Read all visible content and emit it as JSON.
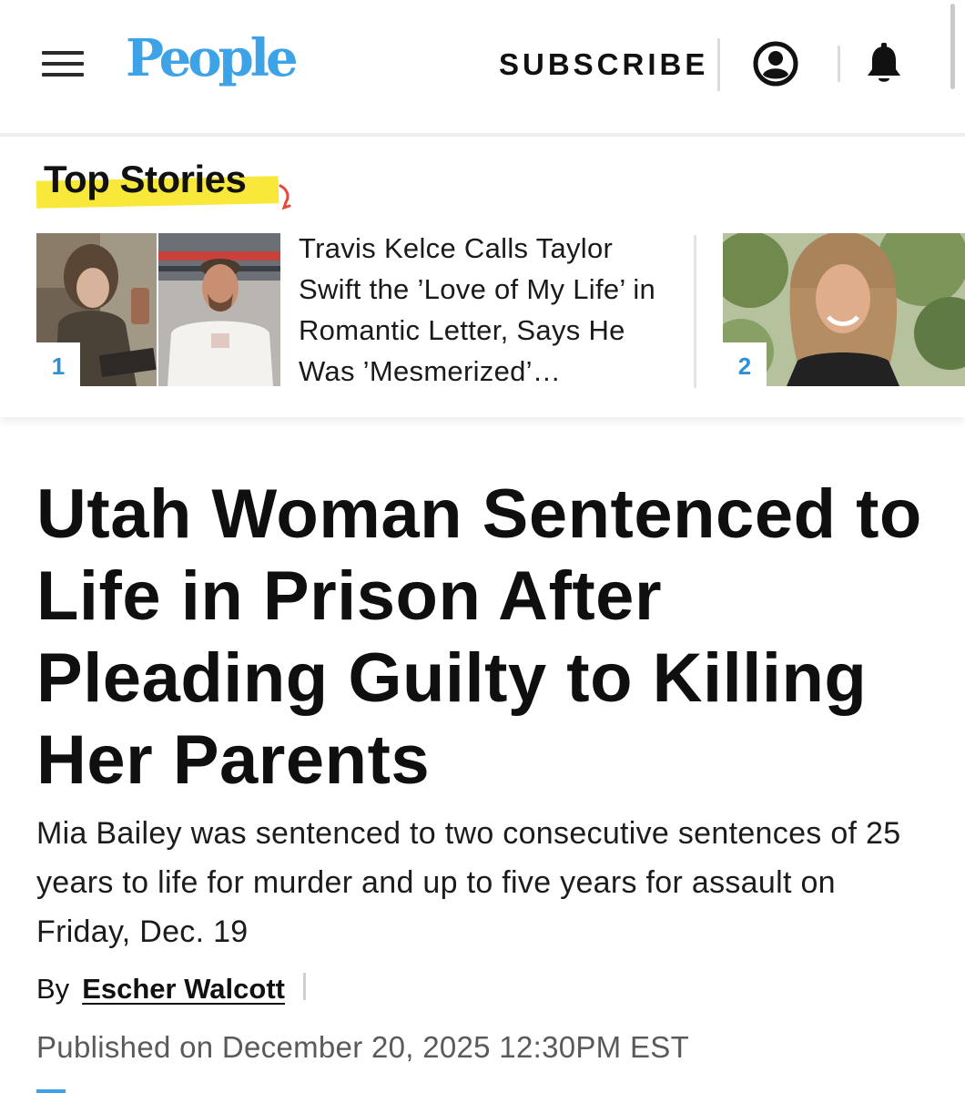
{
  "header": {
    "logo": "People",
    "subscribe_label": "SUBSCRIBE",
    "brand_color": "#3ea3e6",
    "icons": [
      "menu-icon",
      "account-icon",
      "bell-icon"
    ]
  },
  "top_stories": {
    "heading": "Top Stories",
    "highlight_color": "#f7e83a",
    "items": [
      {
        "rank": "1",
        "title": "Travis Kelce Calls Taylor Swift the ’Love of My Life’ in Romantic Letter, Says He Was ’Mesmerized’…"
      },
      {
        "rank": "2",
        "title": ""
      }
    ]
  },
  "article": {
    "headline": "Utah Woman Sentenced to Life in Prison After Pleading Guilty to Killing Her Parents",
    "dek": "Mia Bailey was sentenced to two consecutive sentences of 25 years to life for murder and up to five years for assault on Friday, Dec. 19",
    "byline_prefix": "By",
    "author": "Escher Walcott",
    "published": "Published on December 20, 2025 12:30PM EST"
  }
}
